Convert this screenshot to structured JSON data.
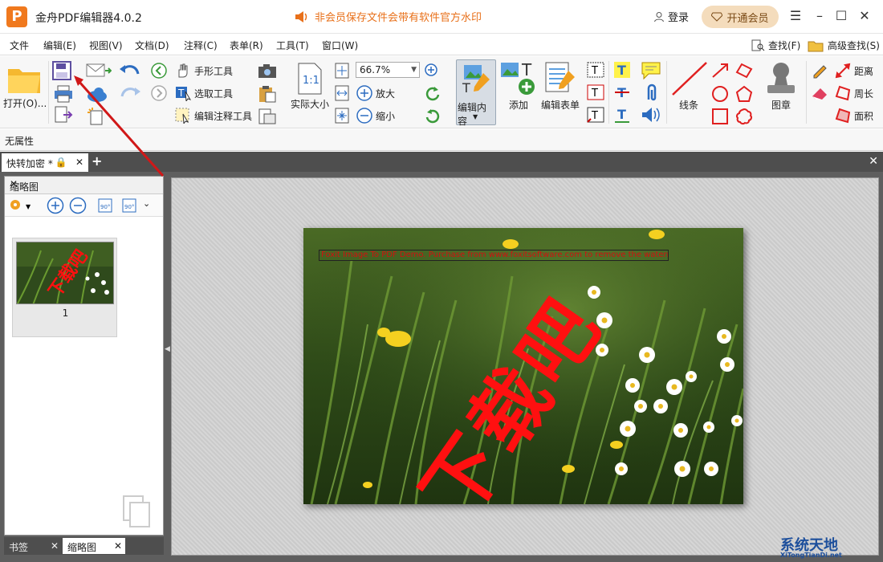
{
  "app": {
    "logo": "P",
    "title": "金舟PDF编辑器4.0.2",
    "notice": "非会员保存文件会带有软件官方水印",
    "login": "登录",
    "vip": "开通会员"
  },
  "menu": {
    "items": [
      "文件",
      "编辑(E)",
      "视图(V)",
      "文档(D)",
      "注释(C)",
      "表单(R)",
      "工具(T)",
      "窗口(W)"
    ],
    "find": "查找(F)",
    "advanced_find": "高级查找(S)"
  },
  "ribbon": {
    "open": "打开(O)...",
    "hand": "手形工具",
    "select": "选取工具",
    "edit_annot": "编辑注释工具",
    "actual_size": "实际大小",
    "zoom": "66.7%",
    "zoom_in": "放大",
    "zoom_out": "缩小",
    "edit_content": "编辑内容",
    "add": "添加",
    "edit_form": "编辑表单",
    "line": "线条",
    "stamp": "图章",
    "distance": "距离",
    "perimeter": "周长",
    "area": "面积"
  },
  "properties": "无属性",
  "tabs": {
    "doc": "快转加密 *",
    "lock": "🔒"
  },
  "panel": {
    "title": "缩略图",
    "page_number": "1",
    "bottom_tabs": [
      "书签",
      "缩略图"
    ]
  },
  "page": {
    "watermark_line": "Foxit Image To PDF Demo. Purchase from www.foxitsoftware.com to remove the watermark",
    "big_watermark": "下载吧"
  },
  "brand": {
    "name": "系统天地",
    "url": "XiTongTianDi.net"
  },
  "colors": {
    "accent": "#f0791e",
    "watermark": "#ff1010",
    "vip_bg": "#f4dcbc",
    "tabbar": "#4e4e4e"
  },
  "icons": [
    "save-icon",
    "email-icon",
    "undo-icon",
    "redo-icon",
    "hand-icon",
    "camera-icon",
    "zoom-in-icon",
    "rotate-icon",
    "line-icon",
    "stamp-icon"
  ]
}
